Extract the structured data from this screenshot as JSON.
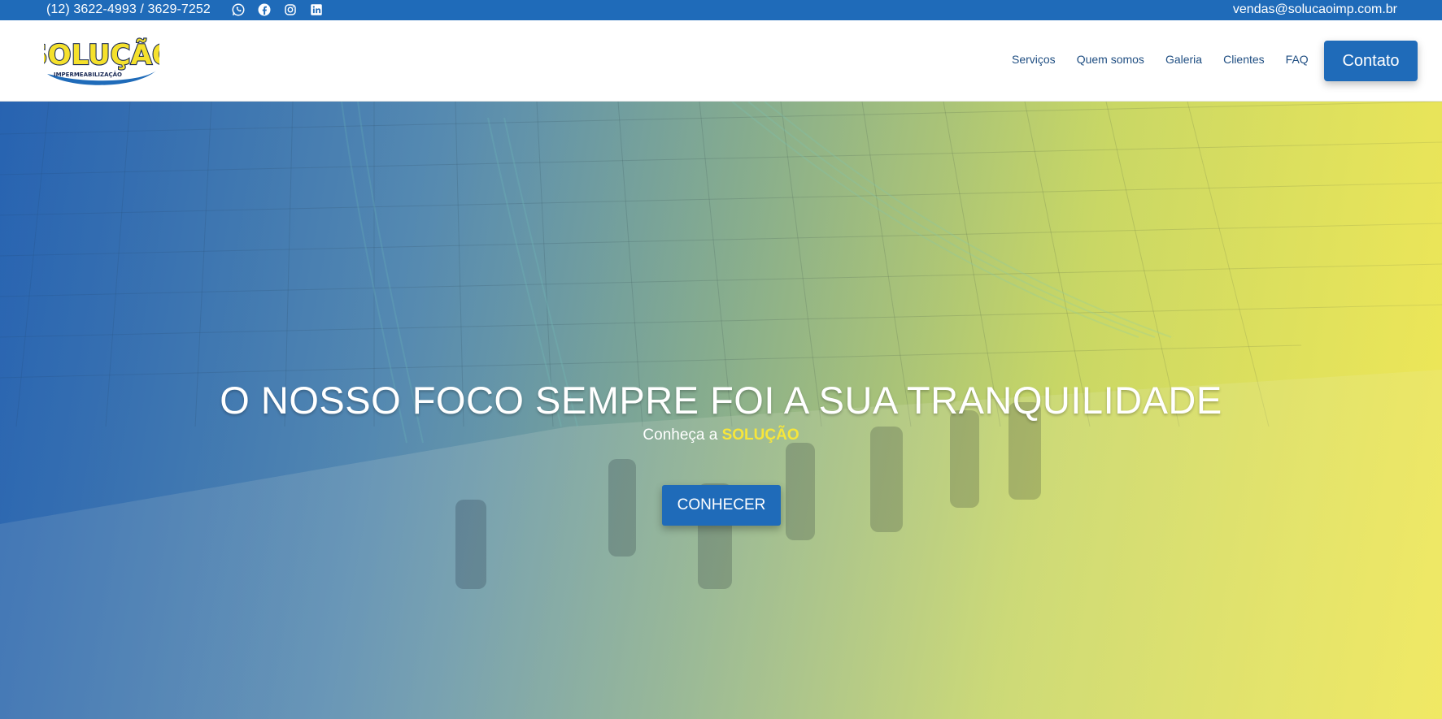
{
  "topbar": {
    "phones": "(12) 3622-4993 / 3629-7252",
    "email": "vendas@solucaoimp.com.br",
    "social": [
      "whatsapp-icon",
      "facebook-icon",
      "instagram-icon",
      "linkedin-icon"
    ]
  },
  "header": {
    "logo_text": "SOLUÇÃO",
    "logo_subtext": "IMPERMEABILIZAÇÃO",
    "nav": [
      "Serviços",
      "Quem somos",
      "Galeria",
      "Clientes",
      "FAQ"
    ],
    "contact_button": "Contato"
  },
  "hero": {
    "title": "O NOSSO FOCO SEMPRE FOI A SUA TRANQUILIDADE",
    "subtitle_prefix": "Conheça a",
    "subtitle_brand": "SOLUÇÃO",
    "cta": "CONHECER"
  },
  "colors": {
    "primary_blue": "#1f6bb9",
    "brand_yellow": "#f7e63a",
    "nav_text": "#1f4e82"
  }
}
